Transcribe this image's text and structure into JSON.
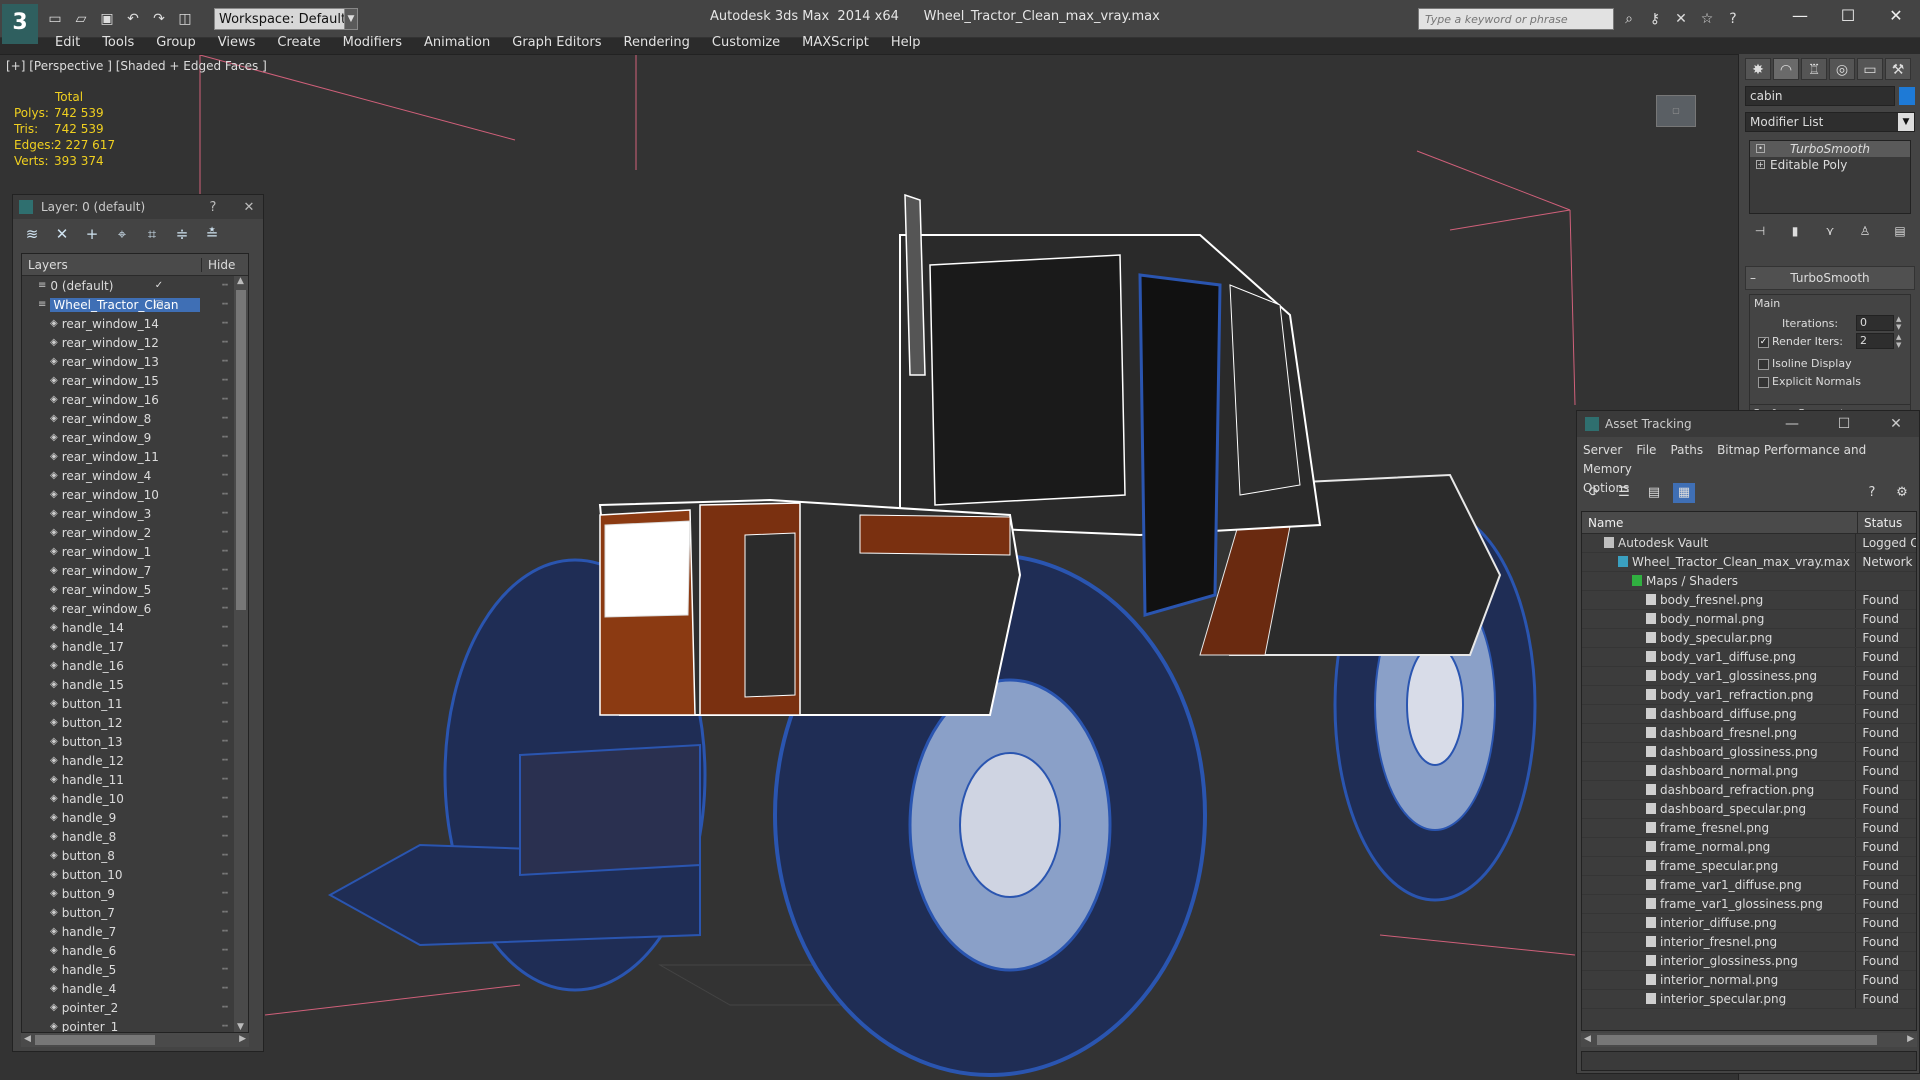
{
  "titlebar": {
    "app_logo": "3",
    "workspace": "Workspace: Default",
    "title": "Autodesk 3ds Max  2014 x64      Wheel_Tractor_Clean_max_vray.max",
    "search_placeholder": "Type a keyword or phrase",
    "icons": [
      "new-icon",
      "open-icon",
      "save-icon",
      "undo-icon",
      "redo-icon",
      "project-icon"
    ]
  },
  "menu": [
    "Edit",
    "Tools",
    "Group",
    "Views",
    "Create",
    "Modifiers",
    "Animation",
    "Graph Editors",
    "Rendering",
    "Customize",
    "MAXScript",
    "Help"
  ],
  "viewport": {
    "label": "[+] [Perspective ] [Shaded + Edged Faces ]",
    "stats": {
      "header": "Total",
      "rows": [
        {
          "label": "Polys:",
          "value": "742 539"
        },
        {
          "label": "Tris:",
          "value": "742 539"
        },
        {
          "label": "Edges:",
          "value": "2 227 617"
        },
        {
          "label": "Verts:",
          "value": "393 374"
        }
      ]
    }
  },
  "layer_panel": {
    "title": "Layer: 0 (default)",
    "help": "?",
    "close": "✕",
    "col_layers": "Layers",
    "col_hide": "Hide",
    "rows": [
      {
        "name": "0 (default)",
        "indent": 1,
        "check": "✓"
      },
      {
        "name": "Wheel_Tractor_Clean",
        "indent": 1,
        "selected": true
      },
      {
        "name": "rear_window_14",
        "indent": 2
      },
      {
        "name": "rear_window_12",
        "indent": 2
      },
      {
        "name": "rear_window_13",
        "indent": 2
      },
      {
        "name": "rear_window_15",
        "indent": 2
      },
      {
        "name": "rear_window_16",
        "indent": 2
      },
      {
        "name": "rear_window_8",
        "indent": 2
      },
      {
        "name": "rear_window_9",
        "indent": 2
      },
      {
        "name": "rear_window_11",
        "indent": 2
      },
      {
        "name": "rear_window_4",
        "indent": 2
      },
      {
        "name": "rear_window_10",
        "indent": 2
      },
      {
        "name": "rear_window_3",
        "indent": 2
      },
      {
        "name": "rear_window_2",
        "indent": 2
      },
      {
        "name": "rear_window_1",
        "indent": 2
      },
      {
        "name": "rear_window_7",
        "indent": 2
      },
      {
        "name": "rear_window_5",
        "indent": 2
      },
      {
        "name": "rear_window_6",
        "indent": 2
      },
      {
        "name": "handle_14",
        "indent": 2
      },
      {
        "name": "handle_17",
        "indent": 2
      },
      {
        "name": "handle_16",
        "indent": 2
      },
      {
        "name": "handle_15",
        "indent": 2
      },
      {
        "name": "button_11",
        "indent": 2
      },
      {
        "name": "button_12",
        "indent": 2
      },
      {
        "name": "button_13",
        "indent": 2
      },
      {
        "name": "handle_12",
        "indent": 2
      },
      {
        "name": "handle_11",
        "indent": 2
      },
      {
        "name": "handle_10",
        "indent": 2
      },
      {
        "name": "handle_9",
        "indent": 2
      },
      {
        "name": "handle_8",
        "indent": 2
      },
      {
        "name": "button_8",
        "indent": 2
      },
      {
        "name": "button_10",
        "indent": 2
      },
      {
        "name": "button_9",
        "indent": 2
      },
      {
        "name": "button_7",
        "indent": 2
      },
      {
        "name": "handle_7",
        "indent": 2
      },
      {
        "name": "handle_6",
        "indent": 2
      },
      {
        "name": "handle_5",
        "indent": 2
      },
      {
        "name": "handle_4",
        "indent": 2
      },
      {
        "name": "pointer_2",
        "indent": 2
      },
      {
        "name": "pointer_1",
        "indent": 2
      }
    ]
  },
  "command_panel": {
    "object_name": "cabin",
    "object_color": "#1e7ad6",
    "modifier_list": "Modifier List",
    "stack": [
      "TurboSmooth",
      "Editable Poly"
    ],
    "rollout": "TurboSmooth",
    "group": "Main",
    "iterations_label": "Iterations:",
    "iterations": "0",
    "render_iters_label": "Render Iters:",
    "render_iters": "2",
    "isoline": "Isoline Display",
    "explicit": "Explicit Normals",
    "surface": "Surface Parameters"
  },
  "asset_tracking": {
    "title": "Asset Tracking",
    "menu": [
      "Server",
      "File",
      "Paths",
      "Bitmap Performance and Memory",
      "Options"
    ],
    "col_name": "Name",
    "col_status": "Status",
    "rows": [
      {
        "name": "Autodesk Vault",
        "status": "Logged O",
        "level": 1
      },
      {
        "name": "Wheel_Tractor_Clean_max_vray.max",
        "status": "Network",
        "level": 2
      },
      {
        "name": "Maps / Shaders",
        "status": "",
        "level": 3
      },
      {
        "name": "body_fresnel.png",
        "status": "Found",
        "level": 4
      },
      {
        "name": "body_normal.png",
        "status": "Found",
        "level": 4
      },
      {
        "name": "body_specular.png",
        "status": "Found",
        "level": 4
      },
      {
        "name": "body_var1_diffuse.png",
        "status": "Found",
        "level": 4
      },
      {
        "name": "body_var1_glossiness.png",
        "status": "Found",
        "level": 4
      },
      {
        "name": "body_var1_refraction.png",
        "status": "Found",
        "level": 4
      },
      {
        "name": "dashboard_diffuse.png",
        "status": "Found",
        "level": 4
      },
      {
        "name": "dashboard_fresnel.png",
        "status": "Found",
        "level": 4
      },
      {
        "name": "dashboard_glossiness.png",
        "status": "Found",
        "level": 4
      },
      {
        "name": "dashboard_normal.png",
        "status": "Found",
        "level": 4
      },
      {
        "name": "dashboard_refraction.png",
        "status": "Found",
        "level": 4
      },
      {
        "name": "dashboard_specular.png",
        "status": "Found",
        "level": 4
      },
      {
        "name": "frame_fresnel.png",
        "status": "Found",
        "level": 4
      },
      {
        "name": "frame_normal.png",
        "status": "Found",
        "level": 4
      },
      {
        "name": "frame_specular.png",
        "status": "Found",
        "level": 4
      },
      {
        "name": "frame_var1_diffuse.png",
        "status": "Found",
        "level": 4
      },
      {
        "name": "frame_var1_glossiness.png",
        "status": "Found",
        "level": 4
      },
      {
        "name": "interior_diffuse.png",
        "status": "Found",
        "level": 4
      },
      {
        "name": "interior_fresnel.png",
        "status": "Found",
        "level": 4
      },
      {
        "name": "interior_glossiness.png",
        "status": "Found",
        "level": 4
      },
      {
        "name": "interior_normal.png",
        "status": "Found",
        "level": 4
      },
      {
        "name": "interior_specular.png",
        "status": "Found",
        "level": 4
      }
    ]
  }
}
